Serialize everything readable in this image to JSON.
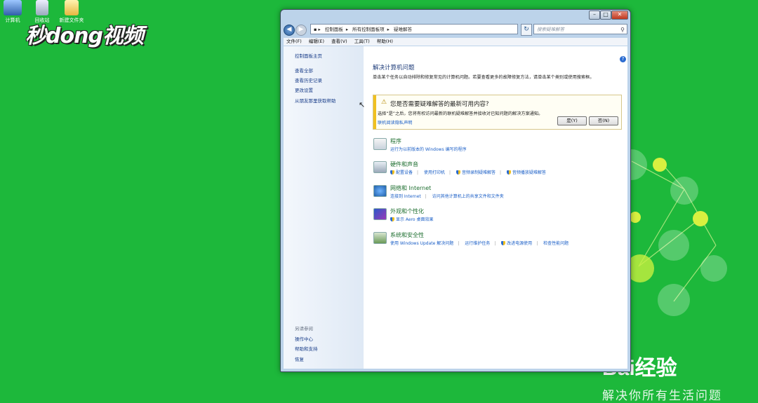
{
  "desktop": {
    "icons": [
      {
        "label": "计算机"
      },
      {
        "label": "回收站"
      },
      {
        "label": "新建文件夹"
      }
    ],
    "watermark_left": "秒dong视频",
    "brand": "Bai经验",
    "brand_sub": "解决你所有生活问题"
  },
  "window": {
    "address": [
      "控制面板",
      "所有控制面板项",
      "疑难解答"
    ],
    "search_placeholder": "搜索疑难解答",
    "menu": [
      "文件(F)",
      "编辑(E)",
      "查看(V)",
      "工具(T)",
      "帮助(H)"
    ],
    "sidebar": {
      "home": "控制面板主页",
      "links": [
        "查看全部",
        "查看历史记录",
        "更改设置",
        "从朋友那里获取帮助"
      ],
      "see_also_heading": "另请参阅",
      "see_also": [
        "操作中心",
        "帮助和支持",
        "恢复"
      ]
    },
    "main": {
      "title": "解决计算机问题",
      "description": "单击某个任务以自动排除和修复常见的计算机问题。若要查看更多的故障修复方法，请单击某个类别或使用搜索框。",
      "notice": {
        "question": "您是否需要疑难解答的最新可用内容?",
        "detail": "选择“是”之后，您将有权访问最新的联机疑难解答并接收对已知问题的解决方案通知。",
        "privacy_link": "联机阅读隐私声明",
        "yes": "是(Y)",
        "no": "否(N)"
      },
      "categories": [
        {
          "title": "程序",
          "links": [
            "运行为以前版本的 Windows 编写的程序"
          ]
        },
        {
          "title": "硬件和声音",
          "links": [
            "配置设备",
            "使用打印机",
            "音频录制疑难解答",
            "音频播放疑难解答"
          ]
        },
        {
          "title": "网络和 Internet",
          "links": [
            "连接到 Internet",
            "访问其他计算机上的共享文件和文件夹"
          ]
        },
        {
          "title": "外观和个性化",
          "links": [
            "显示 Aero 桌面效果"
          ]
        },
        {
          "title": "系统和安全性",
          "links": [
            "使用 Windows Update 解决问题",
            "运行维护任务",
            "改进电源使用",
            "检查性能问题"
          ]
        }
      ]
    }
  }
}
